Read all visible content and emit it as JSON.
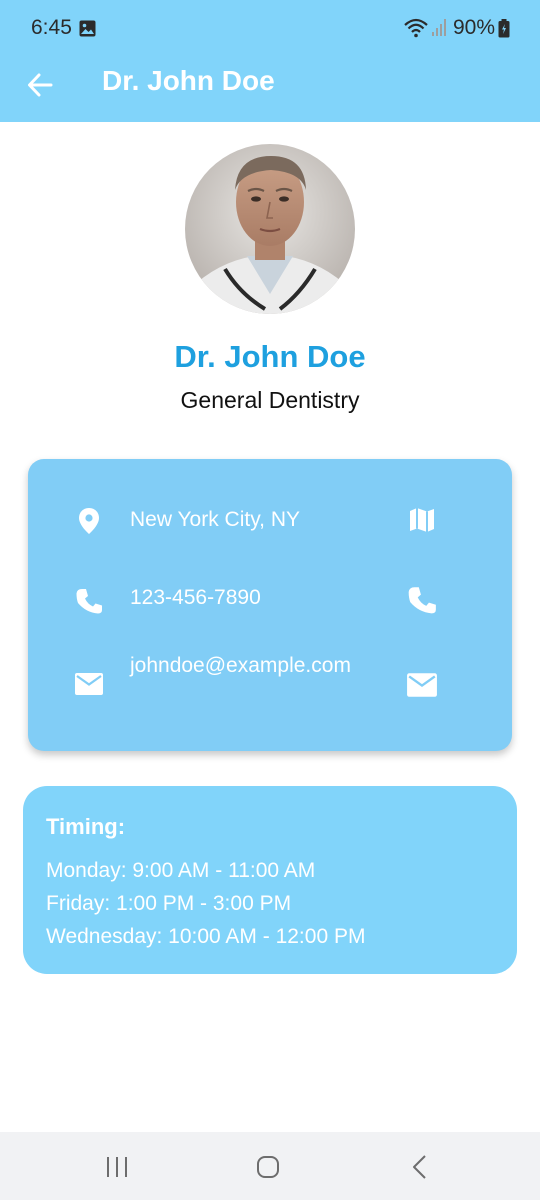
{
  "status_bar": {
    "time": "6:45",
    "battery": "90%",
    "icons": [
      "gallery-icon",
      "wifi-icon",
      "signal-icon",
      "battery-icon"
    ]
  },
  "app_bar": {
    "title": "Dr. John Doe",
    "back_icon": "arrow-back-icon"
  },
  "profile": {
    "name": "Dr. John Doe",
    "specialty": "General Dentistry"
  },
  "contact": {
    "rows": [
      {
        "icon": "location-pin-icon",
        "text": "New York City, NY",
        "action_icon": "map-icon"
      },
      {
        "icon": "phone-icon",
        "text": "123-456-7890",
        "action_icon": "phone-icon"
      },
      {
        "icon": "email-icon",
        "text": "johndoe@example.com",
        "action_icon": "email-icon"
      }
    ]
  },
  "timing": {
    "title": "Timing:",
    "lines": [
      "Monday: 9:00 AM - 11:00 AM",
      "Friday: 1:00 PM - 3:00 PM",
      "Wednesday: 10:00 AM - 12:00 PM"
    ]
  },
  "nav_bar": {
    "buttons": [
      "recents-icon",
      "home-icon",
      "back-nav-icon"
    ]
  },
  "colors": {
    "primary": "#81d4fa",
    "card": "#81cdf6",
    "name": "#1ea0df",
    "nav": "#f1f2f4"
  }
}
